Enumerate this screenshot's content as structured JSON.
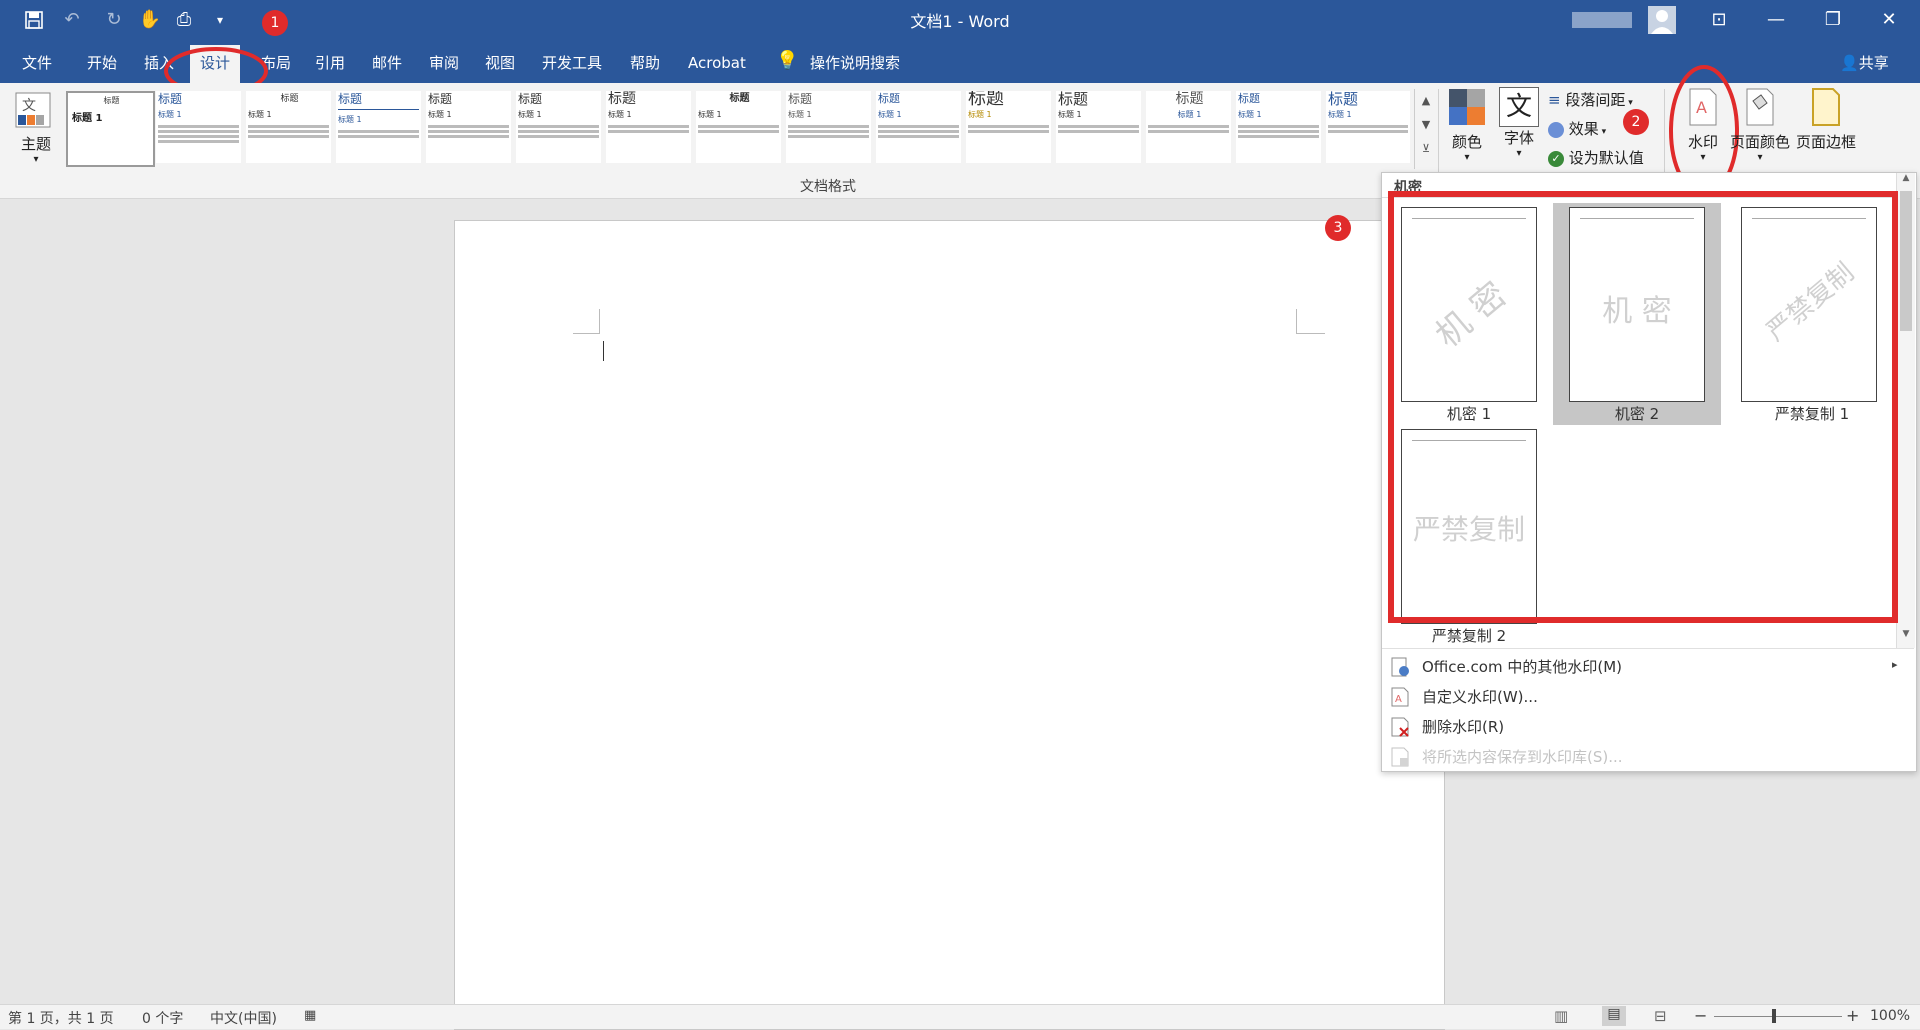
{
  "window": {
    "title": "文档1 - Word"
  },
  "tabs": [
    "文件",
    "开始",
    "插入",
    "设计",
    "布局",
    "引用",
    "邮件",
    "审阅",
    "视图",
    "开发工具",
    "帮助",
    "Acrobat"
  ],
  "active_tab": "设计",
  "tell_me": "操作说明搜索",
  "share": "共享",
  "ribbon": {
    "theme": "主题",
    "colors": "颜色",
    "fonts": "字体",
    "fonts_icon_char": "文",
    "paragraph_spacing": "段落间距",
    "effects": "效果",
    "set_default": "设为默认值",
    "watermark": "水印",
    "page_color": "页面颜色",
    "page_borders": "页面边框",
    "group_label": "文档格式",
    "style_heading": "标题",
    "style_sub": "标题 1"
  },
  "dropdown": {
    "section": "机密",
    "items": [
      {
        "text": "机 密",
        "label": "机密 1"
      },
      {
        "text": "机 密",
        "label": "机密 2"
      },
      {
        "text": "严禁复制",
        "label": "严禁复制 1"
      },
      {
        "text": "严禁复制",
        "label": "严禁复制 2"
      }
    ],
    "menu": [
      "Office.com 中的其他水印(M)",
      "自定义水印(W)...",
      "删除水印(R)",
      "将所选内容保存到水印库(S)..."
    ]
  },
  "annotations": [
    "1",
    "2",
    "3"
  ],
  "status": {
    "page": "第 1 页，共 1 页",
    "words": "0 个字",
    "language": "中文(中国)",
    "zoom": "100%"
  },
  "colors": {
    "brand": "#2b579a",
    "annotation": "#e02b2b"
  }
}
